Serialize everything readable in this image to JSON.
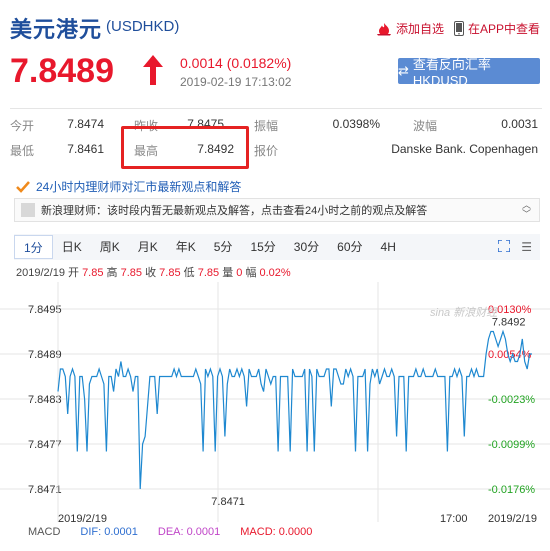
{
  "header": {
    "title": "美元港元",
    "code": "(USDHKD)",
    "add_watch": "添加自选",
    "app_view": "在APP中查看"
  },
  "quote": {
    "price": "7.8489",
    "change": "0.0014 (0.0182%)",
    "datetime": "2019-02-19 17:13:02",
    "reverse_button": "查看反向汇率 HKDUSD"
  },
  "stats": {
    "row1": [
      {
        "label": "今开",
        "value": "7.8474"
      },
      {
        "label": "昨收",
        "value": "7.8475"
      },
      {
        "label": "振幅",
        "value": "0.0398%"
      },
      {
        "label": "波幅",
        "value": "0.0031"
      }
    ],
    "row2": [
      {
        "label": "最低",
        "value": "7.8461"
      },
      {
        "label": "最高",
        "value": "7.8492"
      },
      {
        "label": "报价",
        "value": "Danske Bank. Copenhagen"
      }
    ]
  },
  "analysis_link": "24小时内理财师对汇市最新观点和解答",
  "notice": "新浪理财师：该时段内暂无最新观点及解答，点击查看24小时之前的观点及解答",
  "tabs": [
    "1分",
    "日K",
    "周K",
    "月K",
    "年K",
    "5分",
    "15分",
    "30分",
    "60分",
    "4H"
  ],
  "active_tab": "1分",
  "info_line": {
    "date": "2019/2/19",
    "open_label": "开",
    "open": "7.85",
    "high_label": "高",
    "high": "7.85",
    "close_label": "收",
    "close": "7.85",
    "low_label": "低",
    "low": "7.85",
    "volume_label": "量",
    "volume": "0",
    "amplitude_label": "幅",
    "amplitude": "0.02%"
  },
  "chart_data": {
    "type": "line",
    "y_tick_labels": [
      "7.8495",
      "7.8489",
      "7.8483",
      "7.8477",
      "7.8471"
    ],
    "y_ticks": [
      7.8495,
      7.8489,
      7.8483,
      7.8477,
      7.8471
    ],
    "right_tick_labels": [
      "0.0130%",
      "0.0054%",
      "-0.0023%",
      "-0.0099%",
      "-0.0176%"
    ],
    "x_tick_labels": [
      "2019/2/19",
      "17:00",
      "2019/2/19"
    ],
    "ylim": [
      7.8469,
      7.8497
    ],
    "annotations": [
      {
        "label": "7.8492",
        "x": 186,
        "y": 7.8492
      },
      {
        "label": "7.8471",
        "x": 70,
        "y": 7.8471
      }
    ],
    "watermark": "sina 新浪财经",
    "colors": {
      "line": "#1e88d0",
      "grid": "#e6e6e6",
      "right_pos": "#e8182c",
      "right_neg": "#22a322"
    },
    "series": [
      {
        "values": [
          7.8484,
          7.8487,
          7.8487,
          7.8486,
          7.8481,
          7.8486,
          7.8487,
          7.8486,
          7.8476,
          7.8486,
          7.8486,
          7.8483,
          7.8476,
          7.8485,
          7.8486,
          7.8486,
          7.8486,
          7.8487,
          7.8486,
          7.8485,
          7.8476,
          7.8486,
          7.8486,
          7.8484,
          7.8487,
          7.8486,
          7.8488,
          7.8486,
          7.8486,
          7.8487,
          7.8486,
          7.8484,
          7.8486,
          7.8486,
          7.8471,
          7.8477,
          7.8478,
          7.8482,
          7.8486,
          7.8486,
          7.8486,
          7.8481,
          7.8486,
          7.8486,
          7.8486,
          7.8486,
          7.8486,
          7.8486,
          7.8487,
          7.8486,
          7.8487,
          7.8486,
          7.8486,
          7.8486,
          7.8486,
          7.8486,
          7.8486,
          7.8487,
          7.8486,
          7.8485,
          7.8476,
          7.8487,
          7.8486,
          7.8487,
          7.8486,
          7.8476,
          7.8486,
          7.8487,
          7.8486,
          7.8478,
          7.8485,
          7.8487,
          7.8486,
          7.8486,
          7.8487,
          7.8486,
          7.8487,
          7.8486,
          7.8482,
          7.8487,
          7.8486,
          7.8486,
          7.8486,
          7.8487,
          7.8485,
          7.8484,
          7.8487,
          7.8486,
          7.8485,
          7.8486,
          7.8486,
          7.8476,
          7.8486,
          7.8486,
          7.8486,
          7.8486,
          7.8476,
          7.8487,
          7.8486,
          7.8486,
          7.8486,
          7.8486,
          7.8487,
          7.8476,
          7.8487,
          7.8486,
          7.8476,
          7.8487,
          7.8486,
          7.8486,
          7.8486,
          7.8487,
          7.8487,
          7.8482,
          7.8487,
          7.8487,
          7.8486,
          7.8485,
          7.8485,
          7.8487,
          7.8486,
          7.8487,
          7.8486,
          7.8476,
          7.8486,
          7.8486,
          7.8486,
          7.8487,
          7.8476,
          7.8485,
          7.8487,
          7.8486,
          7.8487,
          7.8485,
          7.8486,
          7.8487,
          7.8486,
          7.8486,
          7.8487,
          7.8486,
          7.8478,
          7.8486,
          7.8486,
          7.8486,
          7.8476,
          7.8486,
          7.8486,
          7.8486,
          7.8487,
          7.8486,
          7.8486,
          7.8487,
          7.8486,
          7.8486,
          7.8486,
          7.8486,
          7.8487,
          7.8486,
          7.8486,
          7.8486,
          7.8486,
          7.8476,
          7.8486,
          7.8486,
          7.8487,
          7.8486,
          7.8487,
          7.8486,
          7.8478,
          7.8486,
          7.8486,
          7.8487,
          7.8486,
          7.8487,
          7.8486,
          7.8486,
          7.8486,
          7.8489,
          7.8491,
          7.8492,
          7.8492,
          7.8491,
          7.849,
          7.8491,
          7.8492,
          7.8491,
          7.8489,
          7.8488,
          7.8489,
          7.8488,
          7.8488,
          7.8489,
          7.8491,
          7.8488,
          7.8487,
          7.8489,
          7.8489
        ]
      }
    ]
  }
}
